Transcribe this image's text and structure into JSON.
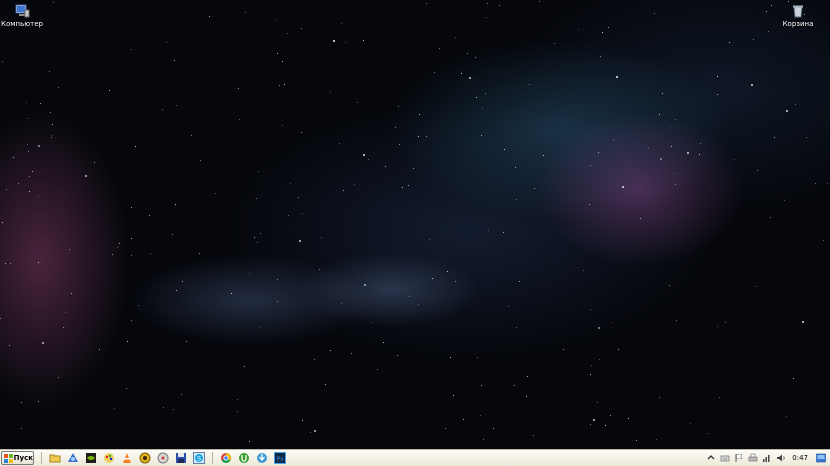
{
  "desktop": {
    "icons": [
      {
        "label": "Компьютер",
        "icon": "computer-icon"
      },
      {
        "label": "Корзина",
        "icon": "recycle-bin-icon"
      }
    ]
  },
  "taskbar": {
    "start_label": "Пуск",
    "quicklaunch": [
      {
        "name": "show-desktop-icon"
      },
      {
        "name": "folder-icon"
      },
      {
        "name": "network-icon"
      },
      {
        "name": "nvidia-icon"
      },
      {
        "name": "paint-icon"
      },
      {
        "name": "vlc-icon"
      },
      {
        "name": "game-icon"
      },
      {
        "name": "media-icon"
      },
      {
        "name": "floppy-save-icon"
      },
      {
        "name": "skype-icon"
      },
      {
        "name": "chrome-icon"
      },
      {
        "name": "utorrent-icon"
      },
      {
        "name": "downloader-icon"
      },
      {
        "name": "photoshop-icon"
      }
    ],
    "tray": {
      "clock": "0:47",
      "items": [
        "expand-tray-icon",
        "keyboard-icon",
        "flag-icon",
        "printer-icon",
        "signal-icon",
        "speaker-icon"
      ]
    }
  },
  "colors": {
    "taskbar_bg": "#ece9d8",
    "desktop_bg": "#05070c"
  }
}
